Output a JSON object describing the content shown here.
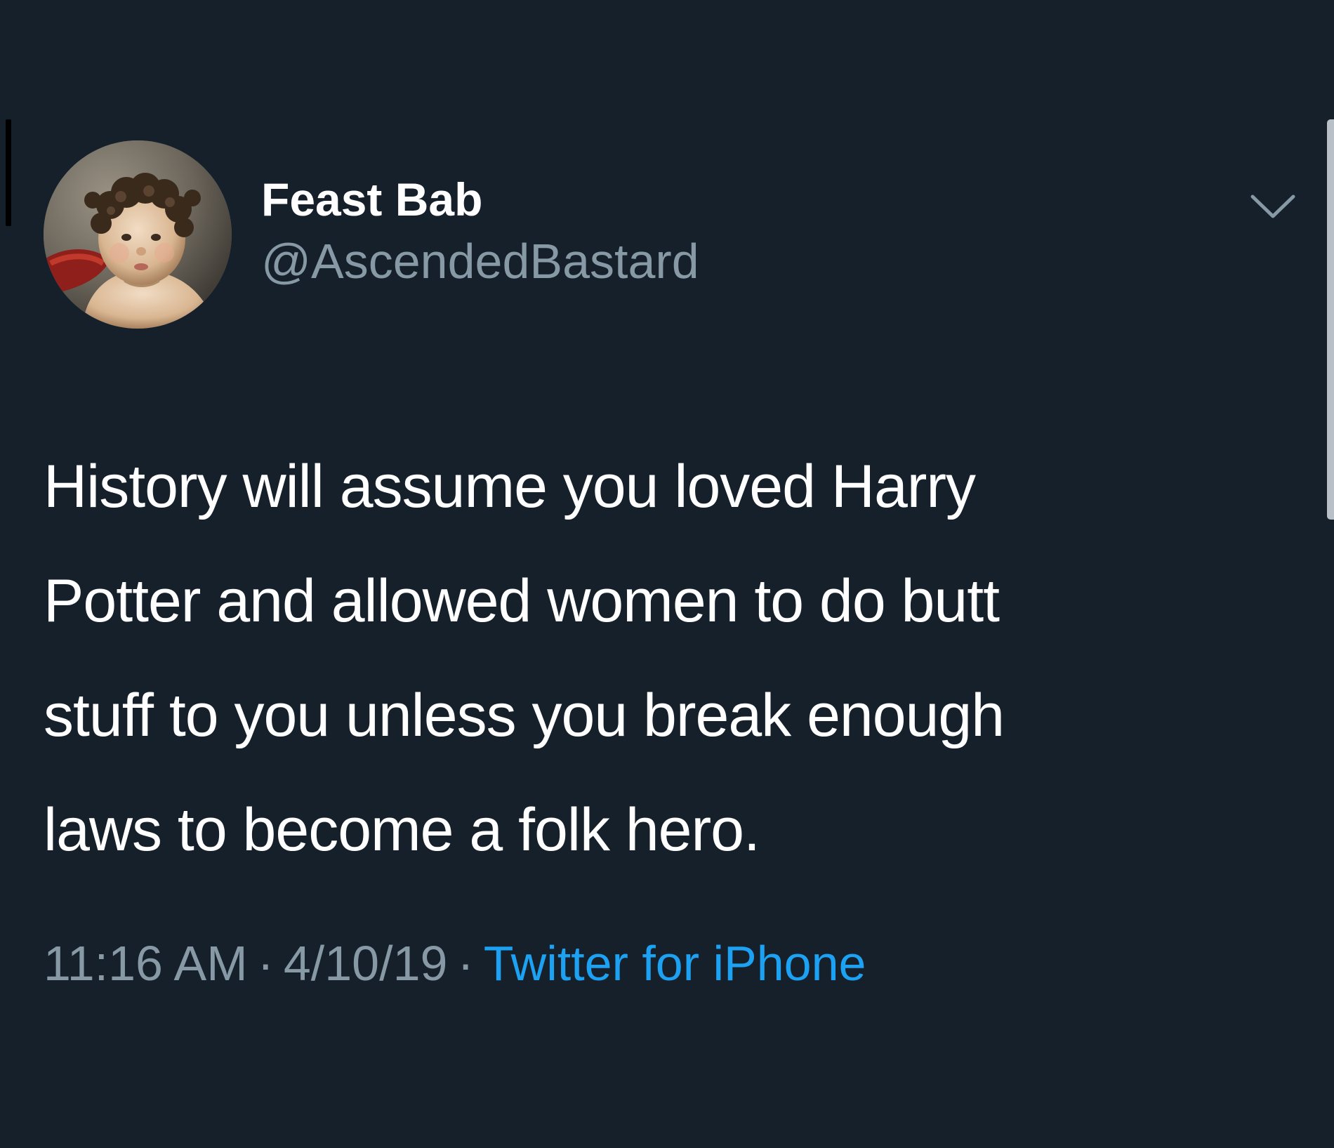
{
  "tweet": {
    "author": {
      "display_name": "Feast Bab",
      "handle": "@AscendedBastard",
      "avatar_icon": "avatar-painting-cherub"
    },
    "text_lines": [
      "History will assume you loved Harry",
      "Potter and allowed women to do butt",
      "stuff to you unless you break enough",
      "laws to become a folk hero."
    ],
    "time": "11:16 AM",
    "separator": "·",
    "date": "4/10/19",
    "source": "Twitter for iPhone",
    "menu_icon": "chevron-down-icon"
  },
  "colors": {
    "background": "#15202b",
    "primary_text": "#ffffff",
    "secondary_text": "#8899a6",
    "link": "#1da1f2"
  }
}
